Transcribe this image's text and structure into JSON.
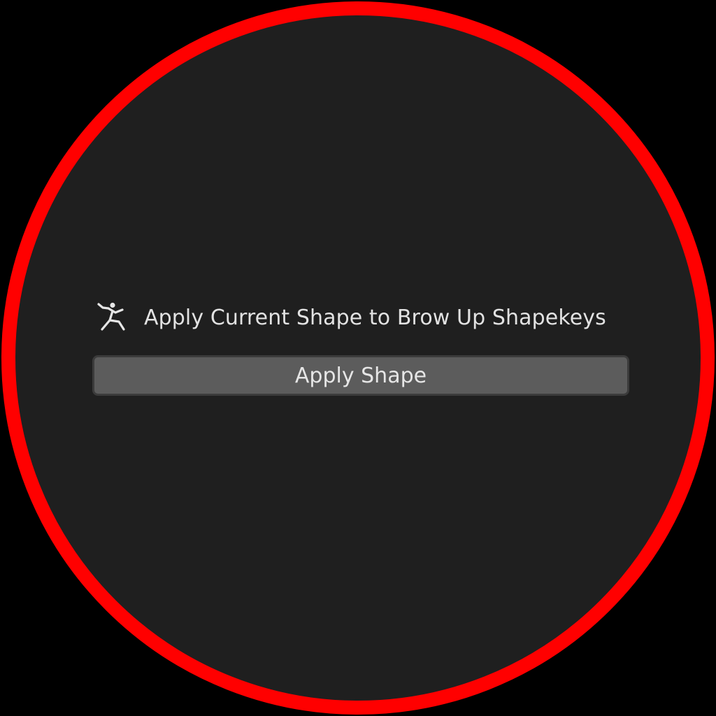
{
  "panel": {
    "header": {
      "icon": "armature-pose-icon",
      "label": "Apply Current Shape to Brow Up Shapekeys"
    },
    "button": {
      "label": "Apply Shape"
    }
  },
  "colors": {
    "frame_border": "#ff0000",
    "panel_background": "#1f1f1f",
    "button_background": "#5c5c5c",
    "text": "#e2e2e2"
  }
}
